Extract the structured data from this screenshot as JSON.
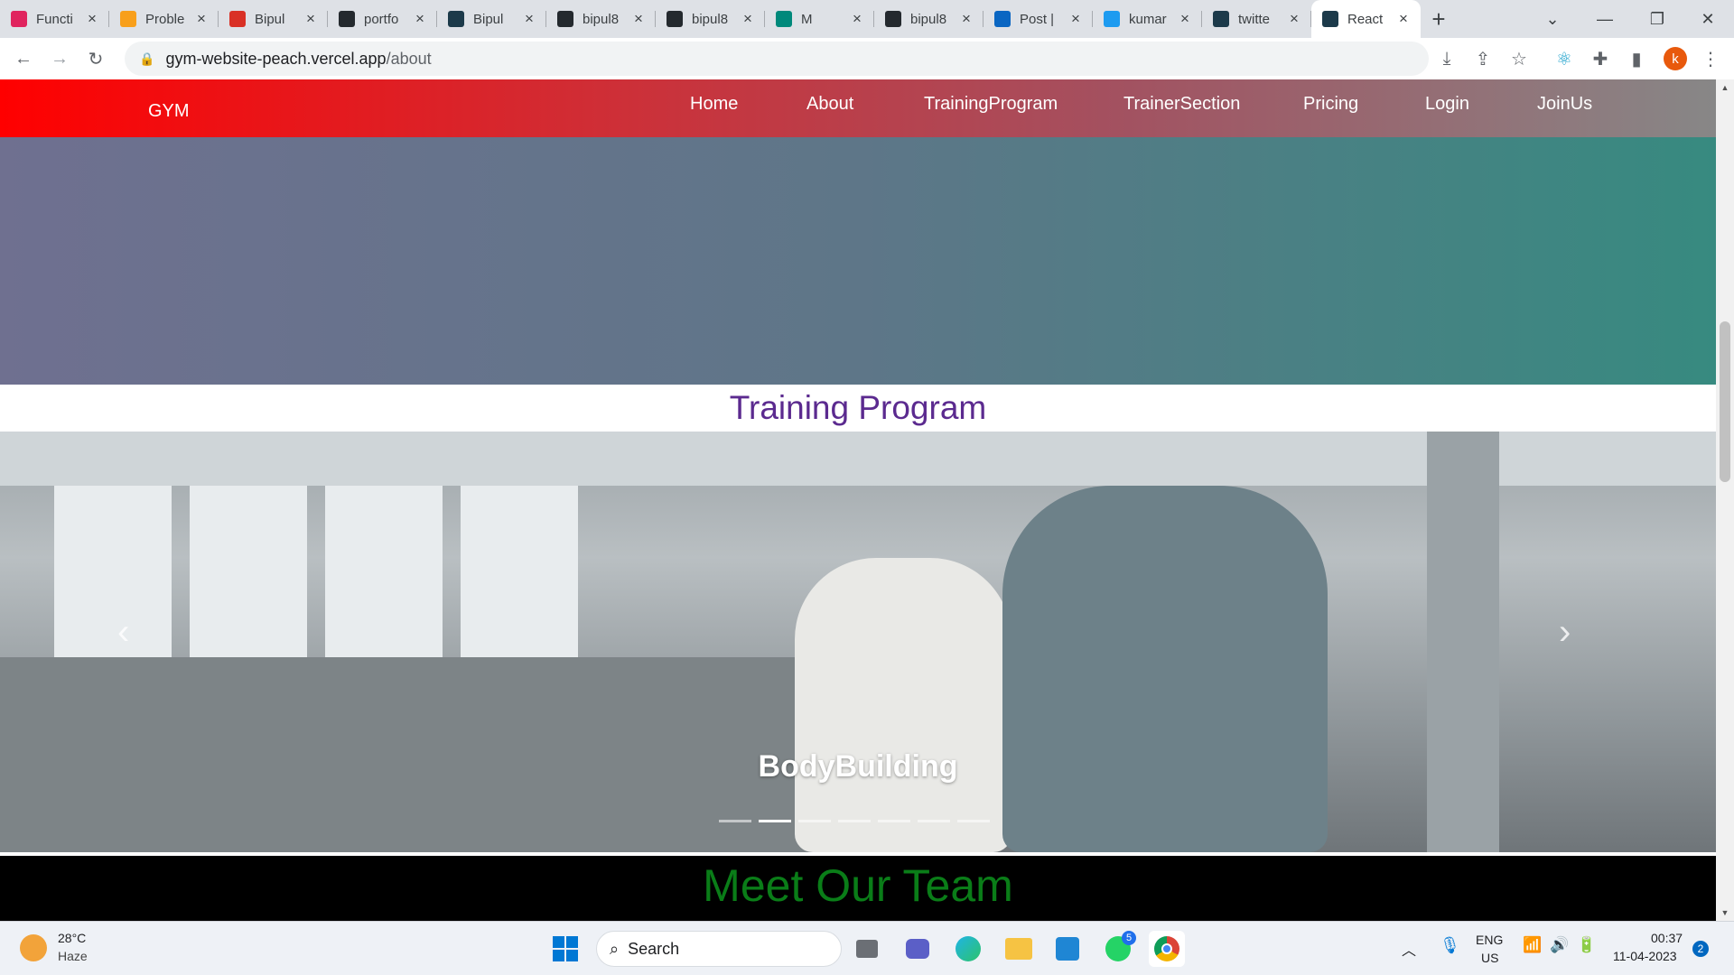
{
  "browser": {
    "tabs": [
      {
        "label": "Functi",
        "icon": "shield-icon",
        "color": "#e0245e"
      },
      {
        "label": "Proble",
        "icon": "leetcode-icon",
        "color": "#f89f1b"
      },
      {
        "label": "Bipul",
        "icon": "gmail-icon",
        "color": "#d93025"
      },
      {
        "label": "portfo",
        "icon": "github-icon",
        "color": "#24292e"
      },
      {
        "label": "Bipul",
        "icon": "react-icon",
        "color": "#1c3a4a"
      },
      {
        "label": "bipul8",
        "icon": "github-icon",
        "color": "#24292e"
      },
      {
        "label": "bipul8",
        "icon": "github-icon",
        "color": "#24292e"
      },
      {
        "label": "M",
        "icon": "meet-icon",
        "color": "#00897b"
      },
      {
        "label": "bipul8",
        "icon": "github-icon",
        "color": "#24292e"
      },
      {
        "label": "Post |",
        "icon": "linkedin-icon",
        "color": "#0a66c2"
      },
      {
        "label": "kumar",
        "icon": "twitter-icon",
        "color": "#1d9bf0"
      },
      {
        "label": "twitte",
        "icon": "react-icon",
        "color": "#1c3a4a"
      },
      {
        "label": "React",
        "icon": "react-icon",
        "color": "#1c3a4a",
        "active": true
      }
    ],
    "url_host": "gym-website-peach.vercel.app",
    "url_path": "/about",
    "profile_initial": "k"
  },
  "site": {
    "brand": "GYM",
    "nav": [
      "Home",
      "About",
      "TrainingProgram",
      "TrainerSection",
      "Pricing",
      "Login",
      "JoinUs"
    ],
    "training_title": "Training Program",
    "carousel_caption": "BodyBuilding",
    "carousel_slides": 7,
    "carousel_active": 1,
    "team_title": "Meet Our Team",
    "accent_purple": "#5b2a8f",
    "accent_green": "#0a7d18"
  },
  "taskbar": {
    "weather_temp": "28°C",
    "weather_desc": "Haze",
    "search_label": "Search",
    "lang_top": "ENG",
    "lang_bottom": "US",
    "time": "00:37",
    "date": "11-04-2023",
    "notification_count": "2",
    "whatsapp_badge": "5"
  }
}
